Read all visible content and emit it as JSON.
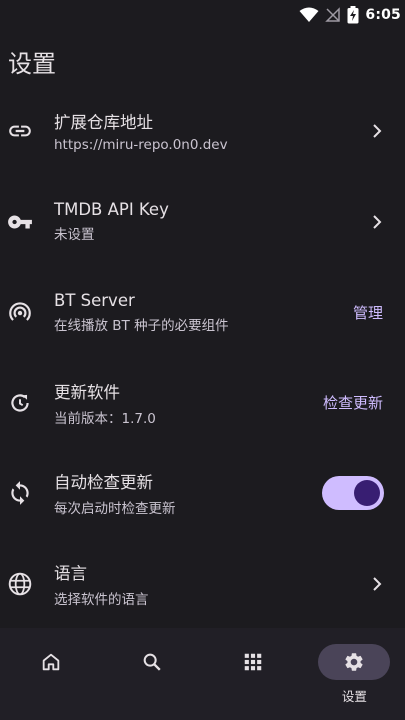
{
  "status_bar": {
    "time": "6:05",
    "icons": [
      "wifi-icon",
      "no-signal-icon",
      "battery-charging-icon"
    ]
  },
  "page": {
    "title": "设置"
  },
  "settings": {
    "repo": {
      "icon": "link-icon",
      "title": "扩展仓库地址",
      "subtitle": "https://miru-repo.0n0.dev",
      "trailing": "chevron-right-icon"
    },
    "tmdb": {
      "icon": "key-icon",
      "title": "TMDB API Key",
      "subtitle": "未设置",
      "trailing": "chevron-right-icon"
    },
    "bt": {
      "icon": "broadcast-icon",
      "title": "BT Server",
      "subtitle": "在线播放 BT 种子的必要组件",
      "action_label": "管理"
    },
    "update": {
      "icon": "update-icon",
      "title": "更新软件",
      "subtitle": "当前版本：1.7.0",
      "action_label": "检查更新"
    },
    "auto_update": {
      "icon": "sync-icon",
      "title": "自动检查更新",
      "subtitle": "每次启动时检查更新",
      "toggle_on": true
    },
    "language": {
      "icon": "globe-icon",
      "title": "语言",
      "subtitle": "选择软件的语言",
      "trailing": "chevron-right-icon"
    }
  },
  "nav": {
    "items": [
      {
        "icon": "home-icon",
        "label": ""
      },
      {
        "icon": "search-icon",
        "label": ""
      },
      {
        "icon": "grid-icon",
        "label": ""
      },
      {
        "icon": "gear-icon",
        "label": "设置",
        "active": true
      }
    ]
  },
  "colors": {
    "background": "#1c1b1f",
    "nav_background": "#211f26",
    "accent": "#cfbcff",
    "toggle_thumb": "#381e72",
    "nav_indicator": "#4a4458"
  }
}
